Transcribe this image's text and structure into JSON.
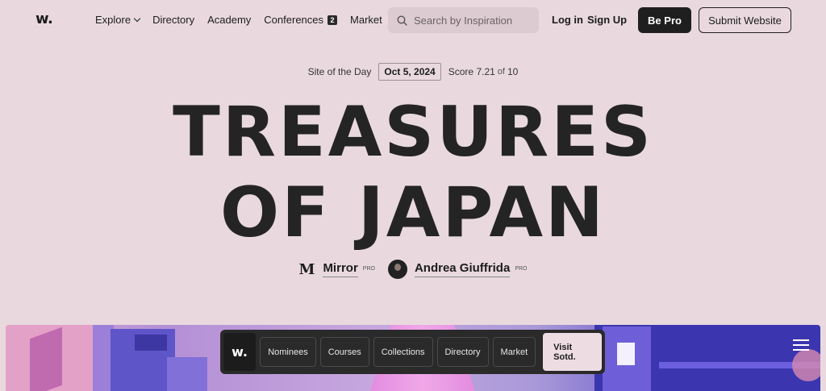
{
  "header": {
    "logo": "w.",
    "nav": [
      {
        "label": "Explore",
        "has_dropdown": true
      },
      {
        "label": "Directory"
      },
      {
        "label": "Academy"
      },
      {
        "label": "Conferences",
        "badge": "2"
      },
      {
        "label": "Market"
      }
    ],
    "search_placeholder": "Search by Inspiration",
    "login": "Log in",
    "signup": "Sign Up",
    "be_pro": "Be Pro",
    "submit": "Submit Website"
  },
  "hero": {
    "label": "Site of the Day",
    "date": "Oct 5, 2024",
    "score_label": "Score",
    "score": "7.21",
    "score_of": "of",
    "score_max": "10",
    "title_line1": "TREASURES",
    "title_line2": "OF JAPAN",
    "credits": [
      {
        "name": "Mirror",
        "badge": "PRO",
        "logo": "M"
      },
      {
        "name": "Andrea Giuffrida",
        "badge": "PRO"
      }
    ]
  },
  "floating_bar": {
    "logo": "w.",
    "items": [
      "Nominees",
      "Courses",
      "Collections",
      "Directory",
      "Market"
    ],
    "cta": "Visit Sotd."
  },
  "colors": {
    "background": "#e9d9df",
    "dark": "#1f1f1f",
    "bar": "#2a2a2a"
  }
}
